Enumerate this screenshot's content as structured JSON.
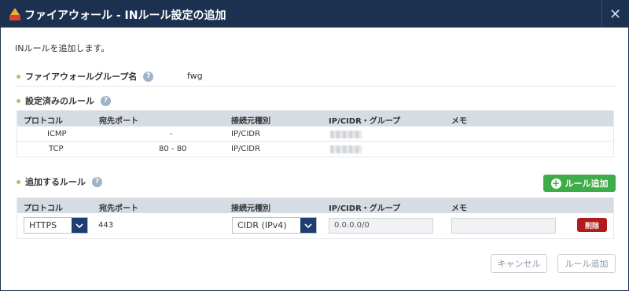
{
  "dialog": {
    "title": "ファイアウォール - INルール設定の追加",
    "close_icon": "close-icon",
    "intro": "INルールを追加します。"
  },
  "firewall_group": {
    "label": "ファイアウォールグループ名",
    "value": "fwg",
    "help": "?"
  },
  "existing_rules": {
    "title": "設定済みのルール",
    "help": "?",
    "columns": [
      "プロトコル",
      "宛先ポート",
      "接続元種別",
      "IP/CIDR・グループ",
      "メモ"
    ],
    "rows": [
      {
        "protocol": "ICMP",
        "port": "-",
        "source_type": "IP/CIDR"
      },
      {
        "protocol": "TCP",
        "port": "80 - 80",
        "source_type": "IP/CIDR"
      }
    ]
  },
  "new_rules": {
    "title": "追加するルール",
    "help": "?",
    "add_button": "ルール追加",
    "columns": [
      "プロトコル",
      "宛先ポート",
      "接続元種別",
      "IP/CIDR・グループ",
      "メモ"
    ],
    "row": {
      "protocol": "HTTPS",
      "port": "443",
      "source_type": "CIDR (IPv4)",
      "ip_cidr": "0.0.0.0/0",
      "memo": "",
      "delete_button": "削除"
    }
  },
  "footer": {
    "cancel": "キャンセル",
    "submit": "ルール追加"
  },
  "colors": {
    "titlebar": "#1c3150",
    "accent_green": "#3eac48",
    "delete_red": "#b01c1c",
    "select_arrow": "#1f3d6e"
  }
}
